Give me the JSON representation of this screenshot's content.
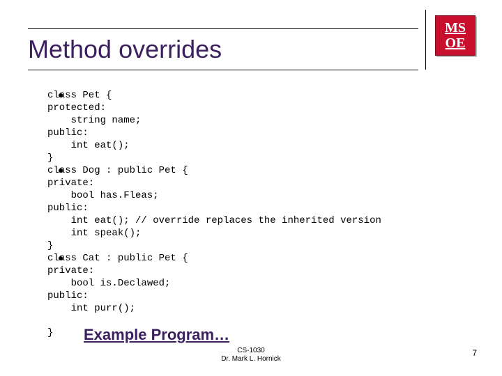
{
  "title": "Method overrides",
  "logo": {
    "line1": "MS",
    "line2": "OE"
  },
  "code": {
    "block1": "class Pet {\nprotected:\n    string name;\npublic:\n    int eat();\n}",
    "block2": "class Dog : public Pet {\nprivate:\n    bool has.Fleas;\npublic:\n    int eat(); // override replaces the inherited version\n    int speak();\n}",
    "block3": "class Cat : public Pet {\nprivate:\n    bool is.Declawed;\npublic:\n    int purr();",
    "closing": "}"
  },
  "example_link": "Example Program…",
  "footer": {
    "course": "CS-1030",
    "author": "Dr. Mark L. Hornick"
  },
  "page_number": "7"
}
